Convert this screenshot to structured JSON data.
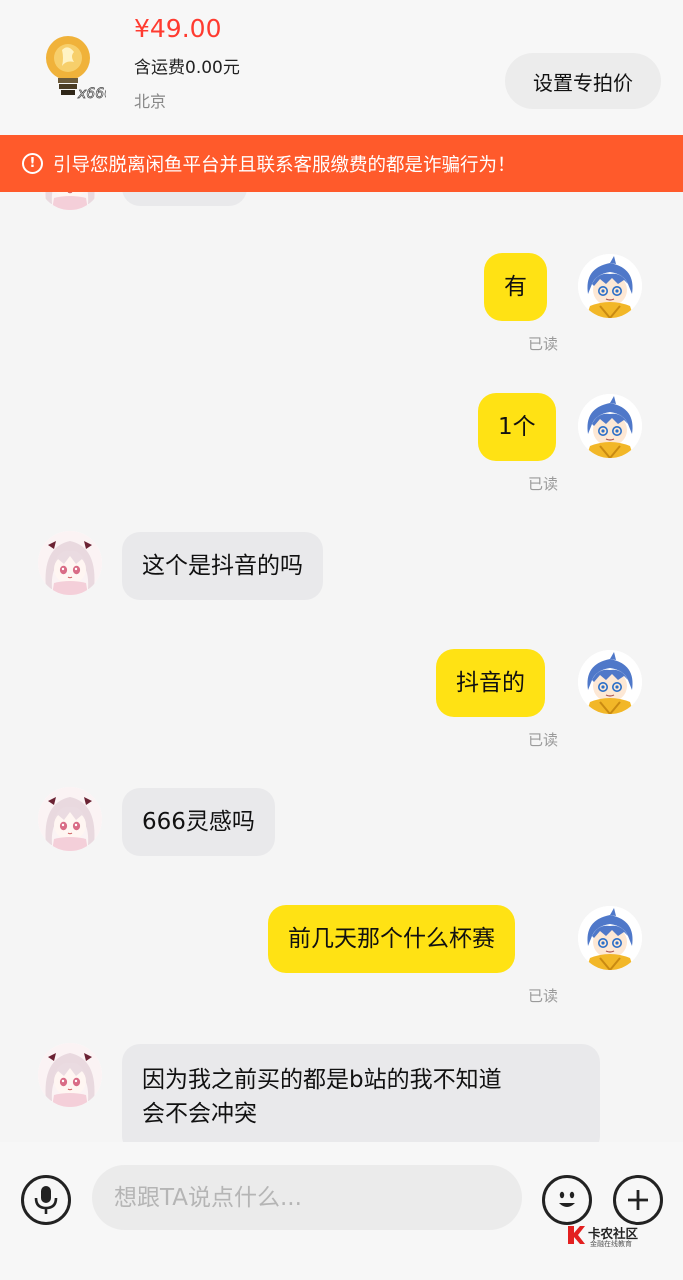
{
  "product": {
    "price": "¥49.00",
    "shipping": "含运费0.00元",
    "location": "北京",
    "image_badge": "x666"
  },
  "header": {
    "set_price_label": "设置专拍价"
  },
  "warning": {
    "text": "引导您脱离闲鱼平台并且联系客服缴费的都是诈骗行为！",
    "icon": "alert-circle-icon"
  },
  "messages": [
    {
      "from": "me",
      "text": "有",
      "status": "已读"
    },
    {
      "from": "me",
      "text": "1个",
      "status": "已读"
    },
    {
      "from": "them",
      "text": "这个是抖音的吗"
    },
    {
      "from": "me",
      "text": "抖音的",
      "status": "已读"
    },
    {
      "from": "them",
      "text": "666灵感吗"
    },
    {
      "from": "me",
      "text": "前几天那个什么杯赛",
      "status": "已读"
    },
    {
      "from": "them",
      "text_lines": [
        "因为我之前买的都是b站的我不知道",
        "会不会冲突"
      ]
    }
  ],
  "input": {
    "placeholder": "想跟TA说点什么...",
    "voice_icon": "microphone-icon",
    "emoji_icon": "smiley-icon",
    "plus_icon": "plus-icon"
  },
  "watermark": {
    "title": "卡农社区",
    "subtitle": "金融在线教育"
  },
  "colors": {
    "accent": "#ffe214",
    "warning": "#ff5a2b",
    "price": "#ff3b30"
  }
}
